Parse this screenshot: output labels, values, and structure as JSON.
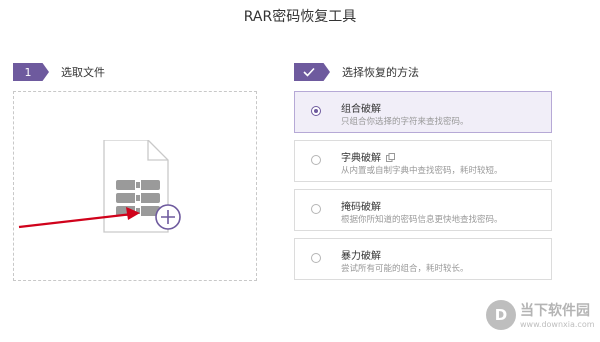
{
  "app": {
    "title": "RAR密码恢复工具"
  },
  "step1": {
    "number": "1",
    "label": "选取文件"
  },
  "step2": {
    "icon": "check-icon",
    "label": "选择恢复的方法"
  },
  "methods": [
    {
      "title": "组合破解",
      "desc": "只组合你选择的字符来查找密码。",
      "selected": true
    },
    {
      "title": "字典破解",
      "desc": "从内置或自制字典中查找密码，耗时较短。",
      "selected": false,
      "extra_icon": "copy-icon"
    },
    {
      "title": "掩码破解",
      "desc": "根据你所知道的密码信息更快地查找密码。",
      "selected": false
    },
    {
      "title": "暴力破解",
      "desc": "尝试所有可能的组合，耗时较长。",
      "selected": false
    }
  ],
  "watermark": {
    "text": "当下软件园",
    "url": "www.downxia.com",
    "logo_glyph": "D"
  },
  "colors": {
    "accent": "#6e5a9e",
    "selected_bg": "#f1eef8",
    "arrow": "#d0021b"
  }
}
